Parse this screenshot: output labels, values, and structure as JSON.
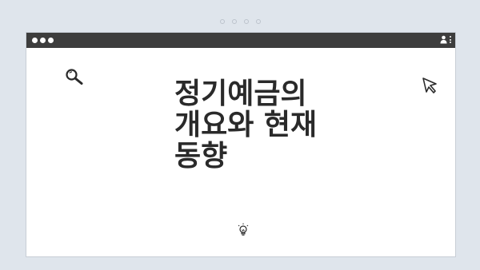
{
  "headline": {
    "line1": "정기예금의",
    "line2": "개요와 현재",
    "line3": "동향"
  },
  "icons": {
    "search": "magnifier-icon",
    "cursor": "cursor-arrow-icon",
    "idea": "lightbulb-icon",
    "user": "user-icon",
    "menu": "kebab-menu-icon"
  },
  "colors": {
    "background": "#dfe5ec",
    "titlebar": "#3d3d3d",
    "window": "#ffffff",
    "text": "#2a2a2a"
  }
}
